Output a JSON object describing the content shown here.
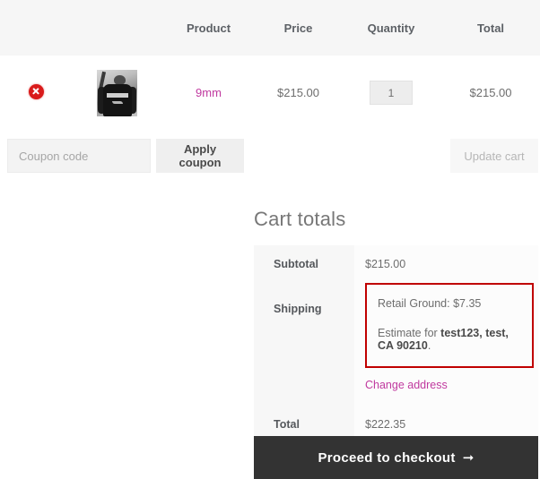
{
  "cart_table": {
    "columns": [
      "",
      "",
      "Product",
      "Price",
      "Quantity",
      "Total"
    ],
    "headers": {
      "product": "Product",
      "price": "Price",
      "quantity": "Quantity",
      "total": "Total"
    },
    "rows": [
      {
        "remove_icon": "remove-circle-icon",
        "thumbnail": "product-thumbnail-9mm",
        "product_name": "9mm",
        "price": "$215.00",
        "quantity": "1",
        "line_total": "$215.00"
      }
    ]
  },
  "coupon": {
    "placeholder": "Coupon code",
    "value": "",
    "apply_label": "Apply coupon",
    "update_cart_label": "Update cart"
  },
  "totals": {
    "heading": "Cart totals",
    "subtotal_label": "Subtotal",
    "subtotal_value": "$215.00",
    "shipping_label": "Shipping",
    "shipping_method": "Retail Ground: $7.35",
    "estimate_prefix": "Estimate for ",
    "estimate_address": "test123, test, CA 90210",
    "estimate_suffix": ".",
    "change_address_label": "Change address",
    "total_label": "Total",
    "total_value": "$222.35"
  },
  "checkout": {
    "label": "Proceed to checkout",
    "arrow": "➞"
  },
  "colors": {
    "link_magenta": "#c0399f",
    "highlight_red": "#c00000",
    "remove_red": "#d91b1b",
    "checkout_dark": "#333333",
    "header_gray": "#f6f6f6"
  }
}
